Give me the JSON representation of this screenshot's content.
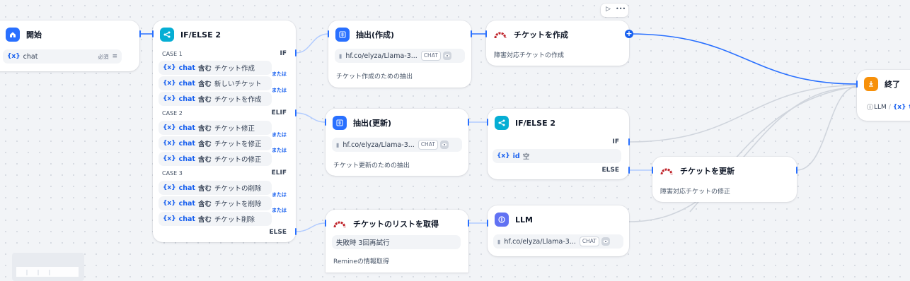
{
  "colors": {
    "accent": "#155eef",
    "edge_active": "#2970ff",
    "edge_idle": "#d0d5dd",
    "canvas": "#f2f4f7"
  },
  "start": {
    "title": "開始",
    "icon": "home-icon",
    "var_icon": "{x}",
    "var_name": "chat",
    "required": "必須"
  },
  "ifelse1": {
    "title": "IF/ELSE 2",
    "icon": "branch-icon",
    "or_label": "または",
    "contains": "含む",
    "var_icon": "{x}",
    "var_name": "chat",
    "cases": [
      {
        "label": "CASE 1",
        "branch": "IF",
        "conditions": [
          "チケット作成",
          "新しいチケット",
          "チケットを作成"
        ]
      },
      {
        "label": "CASE 2",
        "branch": "ELIF",
        "conditions": [
          "チケット修正",
          "チケットを修正",
          "チケットの修正"
        ]
      },
      {
        "label": "CASE 3",
        "branch": "ELIF",
        "conditions": [
          "チケットの削除",
          "チケットを削除",
          "チケット削除"
        ]
      }
    ],
    "else_label": "ELSE"
  },
  "extract_create": {
    "title": "抽出(作成)",
    "icon": "extract-icon",
    "model": "hf.co/elyza/Llama-3...",
    "model_tag": "CHAT",
    "desc": "チケット作成のための抽出"
  },
  "create_ticket": {
    "title": "チケットを作成",
    "icon": "redmine-icon",
    "desc": "障害対応チケットの作成",
    "toolbar": {
      "run": "▷",
      "more": "•••"
    }
  },
  "extract_update": {
    "title": "抽出(更新)",
    "icon": "extract-icon",
    "model": "hf.co/elyza/Llama-3...",
    "model_tag": "CHAT",
    "desc": "チケット更新のための抽出"
  },
  "ifelse2": {
    "title": "IF/ELSE 2",
    "icon": "branch-icon",
    "if_label": "IF",
    "var_icon": "{x}",
    "var_name": "id",
    "cond": "空",
    "else_label": "ELSE"
  },
  "update_ticket": {
    "title": "チケットを更新",
    "icon": "redmine-icon",
    "desc": "障害対応チケットの修正"
  },
  "get_list": {
    "title": "チケットのリストを取得",
    "icon": "redmine-icon",
    "retry": "失敗時 3回再試行",
    "desc": "Remineの情報取得"
  },
  "llm": {
    "title": "LLM",
    "icon": "llm-icon",
    "model": "hf.co/elyza/Llama-3...",
    "model_tag": "CHAT"
  },
  "end": {
    "title": "終了",
    "icon": "end-icon",
    "var1": "LLM",
    "var2_icon": "{x}",
    "var2": "te"
  }
}
